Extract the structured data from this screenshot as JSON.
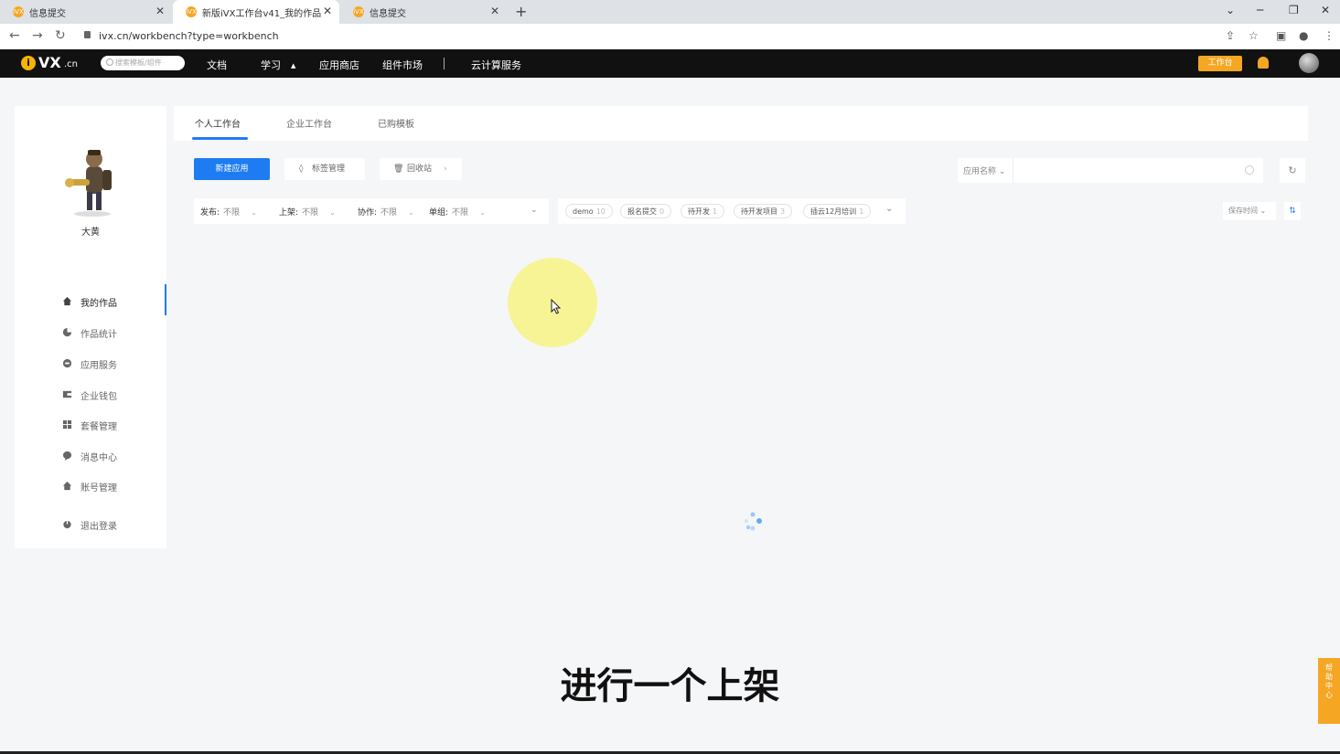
{
  "browser": {
    "tabs": [
      {
        "title": "信息提交",
        "favicon": "iVX"
      },
      {
        "title": "新版iVX工作台v41_我的作品",
        "favicon": "iVX"
      },
      {
        "title": "信息提交",
        "favicon": "iVX"
      }
    ],
    "url": "ivx.cn/workbench?type=workbench"
  },
  "header": {
    "logo_i": "i",
    "logo_text": "VX",
    "logo_suffix": ".cn",
    "search_placeholder": "搜索模板/组件",
    "nav": [
      "文档",
      "学习",
      "应用商店",
      "组件市场",
      "云计算服务"
    ],
    "workbench_button": "工作台"
  },
  "sidebar": {
    "username": "大黄",
    "items": [
      {
        "label": "我的作品",
        "icon": "home-icon",
        "active": true
      },
      {
        "label": "作品统计",
        "icon": "pie-chart-icon"
      },
      {
        "label": "应用服务",
        "icon": "service-icon"
      },
      {
        "label": "企业钱包",
        "icon": "wallet-icon"
      },
      {
        "label": "套餐管理",
        "icon": "grid-icon"
      },
      {
        "label": "消息中心",
        "icon": "message-icon"
      },
      {
        "label": "账号管理",
        "icon": "account-icon"
      },
      {
        "label": "退出登录",
        "icon": "power-icon"
      }
    ]
  },
  "main": {
    "tabs": [
      "个人工作台",
      "企业工作台",
      "已购模板"
    ],
    "active_tab": "个人工作台",
    "toolbar": {
      "new_app": "新建应用",
      "tag_manage": "标签管理",
      "recycle_bin": "回收站"
    },
    "search": {
      "select_label": "应用名称"
    },
    "filters": [
      {
        "label": "发布:",
        "value": "不限"
      },
      {
        "label": "上架:",
        "value": "不限"
      },
      {
        "label": "协作:",
        "value": "不限"
      },
      {
        "label": "单组:",
        "value": "不限"
      }
    ],
    "tags": [
      {
        "name": "demo",
        "count": "10"
      },
      {
        "name": "报名提交",
        "count": "0"
      },
      {
        "name": "待开发",
        "count": "1"
      },
      {
        "name": "待开发项目",
        "count": "3"
      },
      {
        "name": "插云12月培训",
        "count": "1"
      }
    ],
    "sort": {
      "label": "保存时间"
    }
  },
  "subtitle": "进行一个上架",
  "help_tab": "帮助中心",
  "colors": {
    "accent": "#1e7cf2",
    "brand": "#f5a623",
    "header_bg": "#111111",
    "halo": "#f8f380"
  }
}
